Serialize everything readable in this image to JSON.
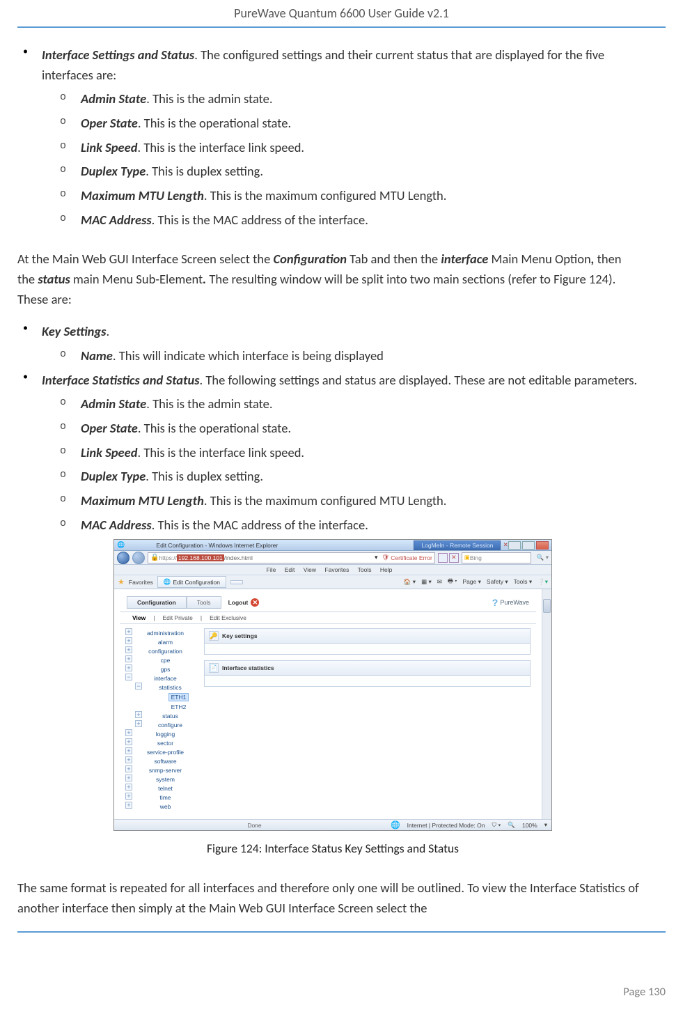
{
  "header": {
    "title": "PureWave Quantum 6600 User Guide v2.1"
  },
  "bullets1": {
    "lead": {
      "term": "Interface Settings and Status",
      "desc": ". The configured settings and their current status that are displayed for the five interfaces are:"
    },
    "sub": [
      {
        "term": "Admin State",
        "desc": ". This is the admin state."
      },
      {
        "term": "Oper State",
        "desc": ". This is the operational state."
      },
      {
        "term": "Link Speed",
        "desc": ". This is the interface link speed."
      },
      {
        "term": "Duplex Type",
        "desc": ". This is duplex setting."
      },
      {
        "term": "Maximum MTU Length",
        "desc": ". This is the maximum configured MTU Length."
      },
      {
        "term": "MAC Address",
        "desc": ". This is the MAC address of the interface."
      }
    ]
  },
  "para1": {
    "p1": "At the Main Web GUI Interface Screen select the ",
    "b1": "Configuration",
    "p2": " Tab and then the ",
    "b2": "interface",
    "p3": " Main Menu Option",
    "comma": ", ",
    "p4": "then the ",
    "b3": "status",
    "p5": " main Menu Sub-Element",
    "dot": ". ",
    "p6": "The resulting window will be split into two main sections (refer to ",
    "ref": "Figure 124",
    "p7": "). These are:"
  },
  "bullets2a": {
    "lead": {
      "term": "Key Settings",
      "desc": "."
    },
    "sub": [
      {
        "term": "Name",
        "desc": ". This will indicate which interface is being displayed"
      }
    ]
  },
  "bullets2b": {
    "lead": {
      "term": "Interface Statistics and Status",
      "desc": ". The following settings and status are displayed. These are not editable parameters."
    },
    "sub": [
      {
        "term": "Admin State",
        "desc": ". This is the admin state."
      },
      {
        "term": "Oper State",
        "desc": ". This is the operational state."
      },
      {
        "term": "Link Speed",
        "desc": ". This is the interface link speed."
      },
      {
        "term": "Duplex Type",
        "desc": ". This is duplex setting."
      },
      {
        "term": "Maximum MTU Length",
        "desc": ". This is the maximum configured MTU Length."
      },
      {
        "term": "MAC Address",
        "desc": ". This is the MAC address of the interface."
      }
    ]
  },
  "figure": {
    "caption": "Figure 124: Interface Status Key Settings and Status",
    "window_title": "Edit Configuration - Windows Internet Explorer",
    "titlebar_tab": "LogMeIn - Remote Session",
    "url_prefix": "https://",
    "url_host": "192.168.100.101",
    "url_suffix": "/index.html",
    "cert_text": "Certificate Error",
    "bing": "Bing",
    "menus": [
      "File",
      "Edit",
      "View",
      "Favorites",
      "Tools",
      "Help"
    ],
    "favorites": "Favorites",
    "page_tab": "Edit Configuration",
    "toolbar_right": [
      "Page",
      "Safety",
      "Tools"
    ],
    "tabs": {
      "config": "Configuration",
      "tools": "Tools",
      "logout": "Logout"
    },
    "brand": "PureWave",
    "subtabs": {
      "view": "View",
      "editp": "Edit Private",
      "edite": "Edit Exclusive"
    },
    "tree": [
      "administration",
      "alarm",
      "configuration",
      "cpe",
      "gps",
      "interface",
      "statistics",
      "ETH1",
      "ETH2",
      "status",
      "configure",
      "logging",
      "sector",
      "service-profile",
      "software",
      "snmp-server",
      "system",
      "telnet",
      "time",
      "web"
    ],
    "panels": {
      "key": "Key settings",
      "stats": "Interface statistics"
    },
    "status": {
      "done": "Done",
      "mode": "Internet | Protected Mode: On",
      "zoom": "100%"
    }
  },
  "para2": "The same format is repeated for all interfaces and therefore only one will be outlined. To view the Interface Statistics of another interface then simply at the Main Web GUI Interface Screen select the",
  "footer": {
    "page": "Page 130"
  }
}
